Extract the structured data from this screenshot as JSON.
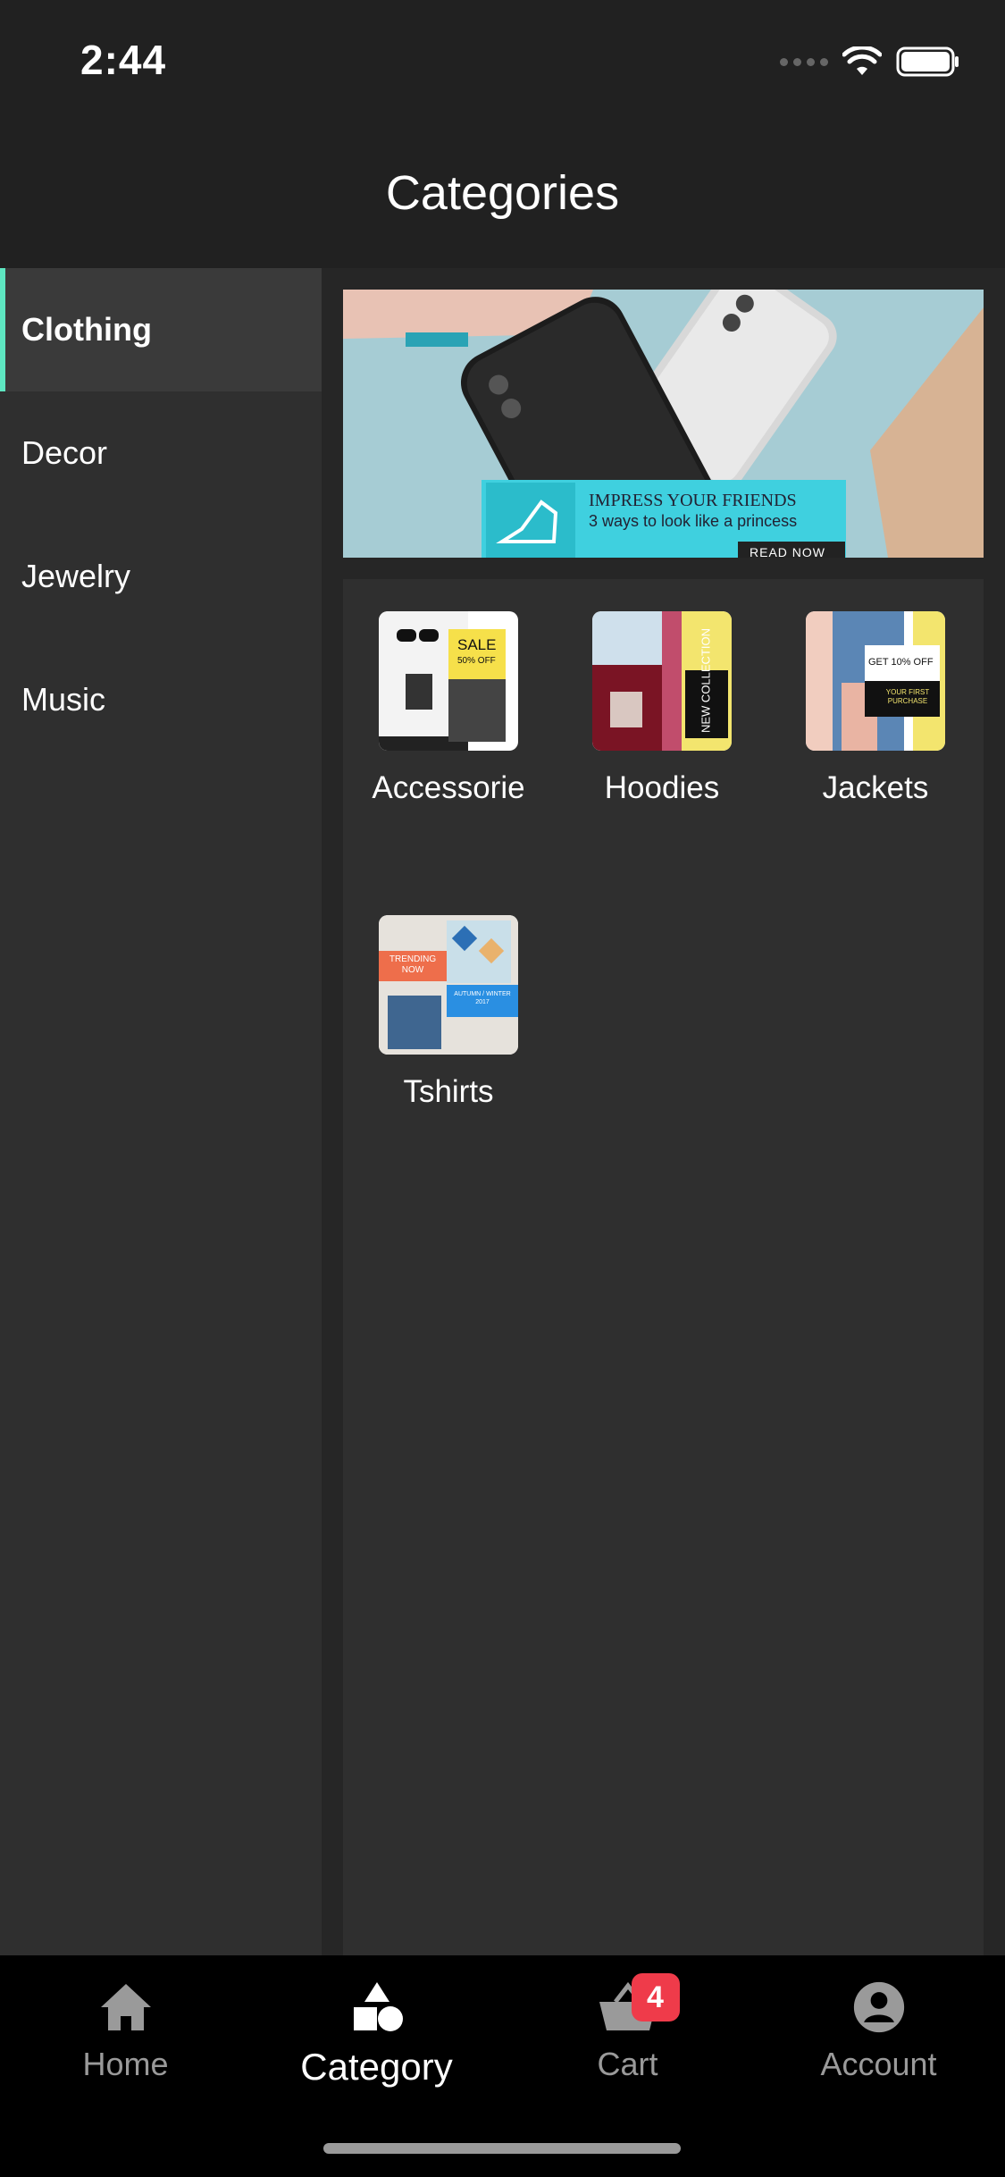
{
  "status": {
    "time": "2:44"
  },
  "header": {
    "title": "Categories"
  },
  "sidebar": {
    "items": [
      {
        "label": "Clothing",
        "active": true
      },
      {
        "label": "Decor",
        "active": false
      },
      {
        "label": "Jewelry",
        "active": false
      },
      {
        "label": "Music",
        "active": false
      }
    ]
  },
  "banner": {
    "headline": "IMPRESS YOUR FRIENDS",
    "subline": "3 ways to look like a princess",
    "cta": "READ NOW"
  },
  "categories": [
    {
      "label": "Accessorie",
      "thumb_text": "SALE",
      "thumb_sub": "50% OFF"
    },
    {
      "label": "Hoodies",
      "thumb_text": "NEW COLLECTION"
    },
    {
      "label": "Jackets",
      "thumb_text": "GET 10% OFF",
      "thumb_sub": "YOUR FIRST PURCHASE"
    },
    {
      "label": "Tshirts",
      "thumb_text": "TRENDING NOW",
      "thumb_sub": "AUTUMN / WINTER 2017"
    }
  ],
  "tabs": [
    {
      "label": "Home",
      "icon": "home-icon"
    },
    {
      "label": "Category",
      "icon": "category-icon",
      "active": true
    },
    {
      "label": "Cart",
      "icon": "cart-icon",
      "badge": "4"
    },
    {
      "label": "Account",
      "icon": "account-icon"
    }
  ],
  "colors": {
    "accent": "#5ee6c1",
    "badge": "#ef3b4a",
    "banner_teal": "#3fd0df"
  }
}
